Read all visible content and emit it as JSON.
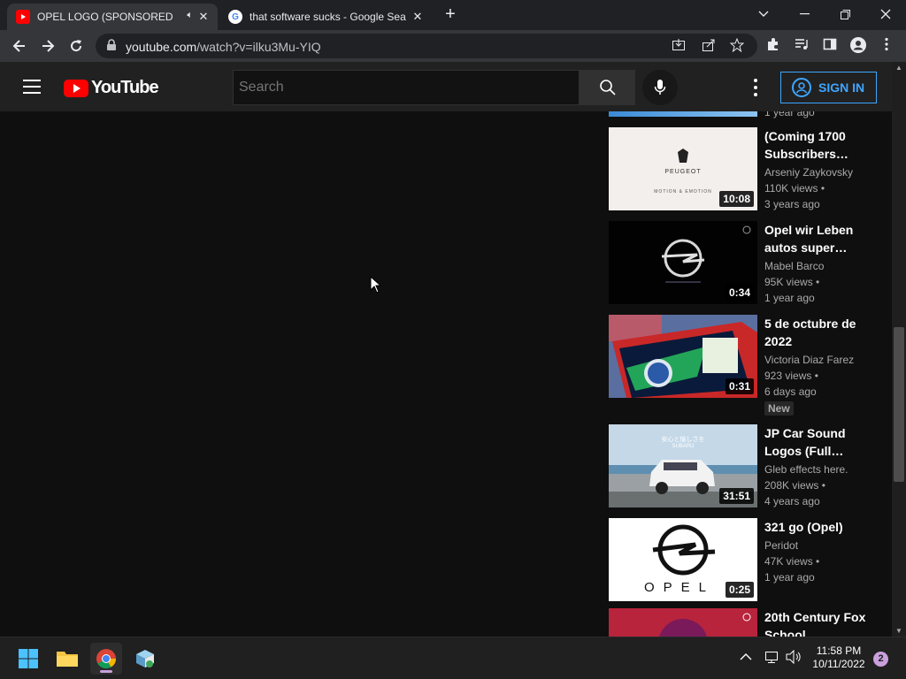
{
  "browser": {
    "tabs": [
      {
        "title": "OPEL LOGO (SPONSORED BY",
        "favicon": "youtube-favicon",
        "audio": "speaker-icon"
      },
      {
        "title": "that software sucks - Google Sea",
        "favicon": "google-favicon"
      }
    ],
    "new_tab_icon": "+",
    "url_host": "youtube.com",
    "url_path": "/watch?v=ilku3Mu-YIQ",
    "window_controls": [
      "chevron-down-icon",
      "minimize-icon",
      "restore-icon",
      "close-icon"
    ]
  },
  "youtube": {
    "logo_text": "YouTube",
    "search_placeholder": "Search",
    "sign_in_label": "SIGN IN",
    "accent": "#3ea6ff",
    "brand_red": "#ff0000"
  },
  "sidebar": {
    "partial_top_age": "1 year ago",
    "videos": [
      {
        "title": "(Coming 1700 Subscribers…",
        "channel": "Arseniy Zaykovsky",
        "views": "110K views",
        "age": "3 years ago",
        "duration": "10:08",
        "thumb_text": "PEUGEOT",
        "thumb_sub": "MOTION & EMOTION"
      },
      {
        "title": "Opel wir Leben autos super…",
        "channel": "Mabel Barco",
        "views": "95K views",
        "age": "1 year ago",
        "duration": "0:34"
      },
      {
        "title": "5 de octubre de 2022",
        "channel": "Victoria Diaz Farez",
        "views": "923 views",
        "age": "6 days ago",
        "duration": "0:31",
        "badge": "New"
      },
      {
        "title": "JP Car Sound Logos (Full…",
        "channel": "Gleb effects here.",
        "views": "208K views",
        "age": "4 years ago",
        "duration": "31:51",
        "thumb_text": "安心と愉しさを",
        "thumb_sub": "SUBARU"
      },
      {
        "title": "321 go (Opel)",
        "channel": "Peridot",
        "views": "47K views",
        "age": "1 year ago",
        "duration": "0:25",
        "thumb_text": "OPEL"
      },
      {
        "title": "20th Century Fox School…",
        "channel": "",
        "views": "",
        "age": "",
        "duration": ""
      }
    ]
  },
  "taskbar": {
    "apps": [
      "windows-start-icon",
      "file-explorer-icon",
      "chrome-icon",
      "app-icon"
    ],
    "time": "11:58 PM",
    "date": "10/11/2022",
    "notification_count": "2"
  }
}
